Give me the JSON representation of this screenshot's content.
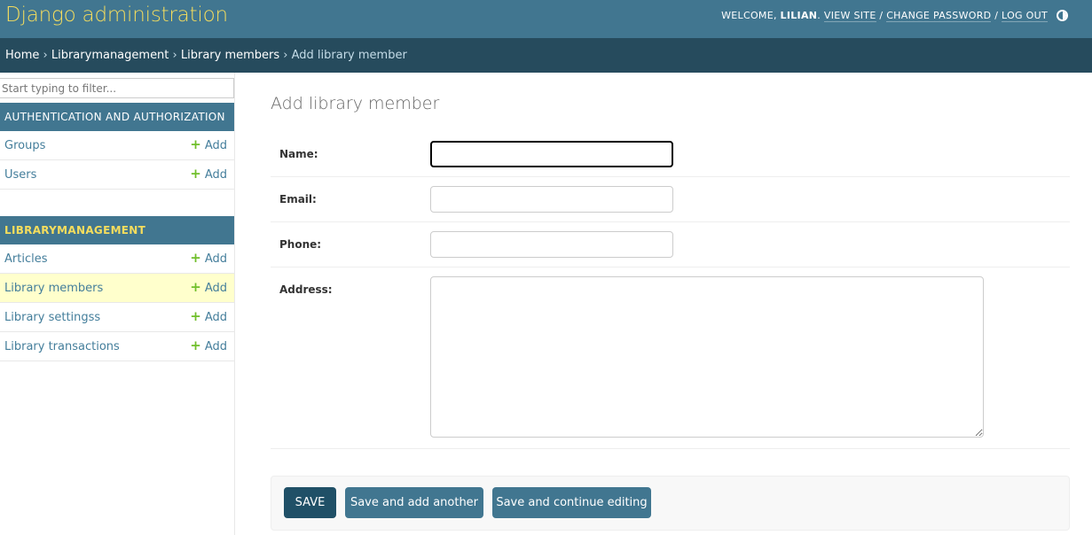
{
  "header": {
    "branding": "Django administration",
    "welcome": "WELCOME, ",
    "username": "LILIAN",
    "after_user": ". ",
    "view_site": "VIEW SITE",
    "sep1": " / ",
    "change_password": "CHANGE PASSWORD",
    "sep2": " / ",
    "log_out": "LOG OUT"
  },
  "breadcrumbs": {
    "home": "Home",
    "sep": " › ",
    "app": "Librarymanagement",
    "model": "Library members",
    "current": "Add library member"
  },
  "sidebar": {
    "filter_placeholder": "Start typing to filter...",
    "auth_caption": "AUTHENTICATION AND AUTHORIZATION",
    "auth_models": [
      {
        "name": "Groups",
        "add": "Add"
      },
      {
        "name": "Users",
        "add": "Add"
      }
    ],
    "library_caption": "LIBRARYMANAGEMENT",
    "library_models": [
      {
        "name": "Articles",
        "add": "Add"
      },
      {
        "name": "Library members",
        "add": "Add"
      },
      {
        "name": "Library settingss",
        "add": "Add"
      },
      {
        "name": "Library transactions",
        "add": "Add"
      }
    ]
  },
  "content": {
    "title": "Add library member",
    "fields": {
      "name": {
        "label": "Name:",
        "value": ""
      },
      "email": {
        "label": "Email:",
        "value": ""
      },
      "phone": {
        "label": "Phone:",
        "value": ""
      },
      "address": {
        "label": "Address:",
        "value": ""
      }
    },
    "buttons": {
      "save": "SAVE",
      "save_add_another": "Save and add another",
      "save_continue": "Save and continue editing"
    }
  },
  "colors": {
    "header_bg": "#417690",
    "breadcrumb_bg": "#264b5d",
    "branding": "#f5dd5d",
    "current_row": "#ffffcc",
    "add_icon": "#70bf2b",
    "default_button": "#205067"
  },
  "icons": {
    "theme_toggle": "half-circle-contrast-icon",
    "add": "plus-icon"
  }
}
